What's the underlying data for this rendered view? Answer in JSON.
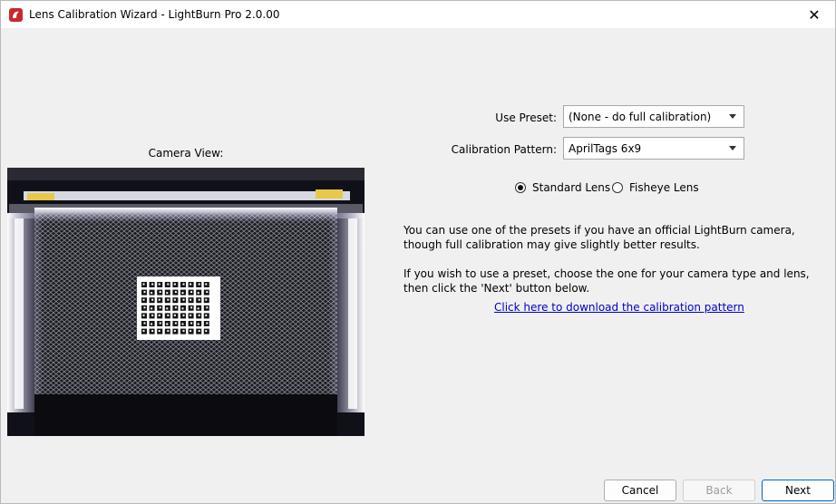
{
  "window": {
    "title": "Lens Calibration Wizard - LightBurn Pro 2.0.00",
    "close_glyph": "✕"
  },
  "camera": {
    "label": "Camera View:"
  },
  "form": {
    "preset_label": "Use Preset:",
    "preset_value": "(None - do full calibration)",
    "pattern_label": "Calibration Pattern:",
    "pattern_value": "AprilTags 6x9",
    "lens_options": [
      {
        "label": "Standard Lens",
        "selected": true
      },
      {
        "label": "Fisheye Lens",
        "selected": false
      }
    ]
  },
  "info": {
    "paragraph1": "You can use one of the presets if you have an official LightBurn camera, though full calibration may give slightly better results.",
    "paragraph2": "If you wish to use a preset, choose the one for your camera type and lens, then click the 'Next' button below.",
    "link": "Click here to download the calibration pattern"
  },
  "buttons": {
    "cancel": "Cancel",
    "back": "Back",
    "next": "Next"
  },
  "icons": {
    "app": "lightburn-logo-icon",
    "close": "close-icon",
    "dropdown": "chevron-down-icon"
  },
  "colors": {
    "link": "#0000cc",
    "app_icon": "#c8282d",
    "primary_border": "#0067c0"
  }
}
